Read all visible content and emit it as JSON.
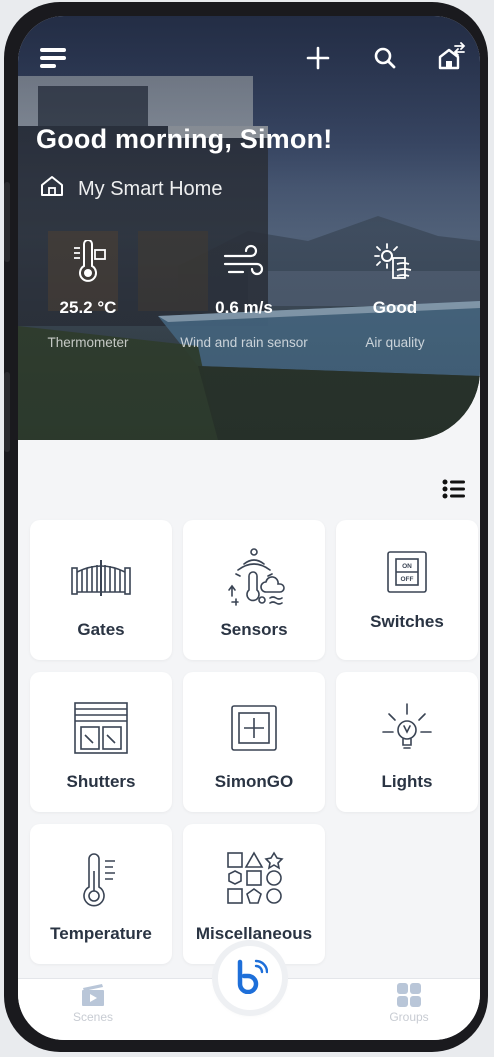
{
  "header": {
    "greeting": "Good morning, Simon!",
    "home_name": "My Smart Home"
  },
  "toolbar": {
    "menu_icon": "hamburger-menu-icon",
    "add_icon": "plus-icon",
    "search_icon": "search-icon",
    "switch_home_icon": "home-switch-icon"
  },
  "stats": [
    {
      "value": "25.2 °C",
      "caption": "Thermometer",
      "icon": "thermometer-icon"
    },
    {
      "value": "0.6 m/s",
      "caption": "Wind and rain sensor",
      "icon": "wind-icon"
    },
    {
      "value": "Good",
      "caption": "Air quality",
      "icon": "air-quality-icon"
    }
  ],
  "view_toggle_icon": "list-view-icon",
  "categories": [
    {
      "label": "Gates",
      "icon": "gate-icon"
    },
    {
      "label": "Sensors",
      "icon": "sensors-icon"
    },
    {
      "label": "Switches",
      "icon": "switch-icon"
    },
    {
      "label": "Shutters",
      "icon": "shutter-icon"
    },
    {
      "label": "SimonGO",
      "icon": "simongo-icon"
    },
    {
      "label": "Lights",
      "icon": "light-bulb-icon"
    },
    {
      "label": "Temperature",
      "icon": "temperature-icon"
    },
    {
      "label": "Miscellaneous",
      "icon": "shapes-icon"
    }
  ],
  "bottom_nav": {
    "scenes": "Scenes",
    "groups": "Groups",
    "center_icon": "voice-assistant-icon"
  },
  "switch_icon_text": {
    "on": "ON",
    "off": "OFF"
  },
  "colors": {
    "accent": "#1e6fd9",
    "tile_bg": "#ffffff",
    "text_dark": "#2a3443",
    "icon_stroke": "#3a4454"
  }
}
